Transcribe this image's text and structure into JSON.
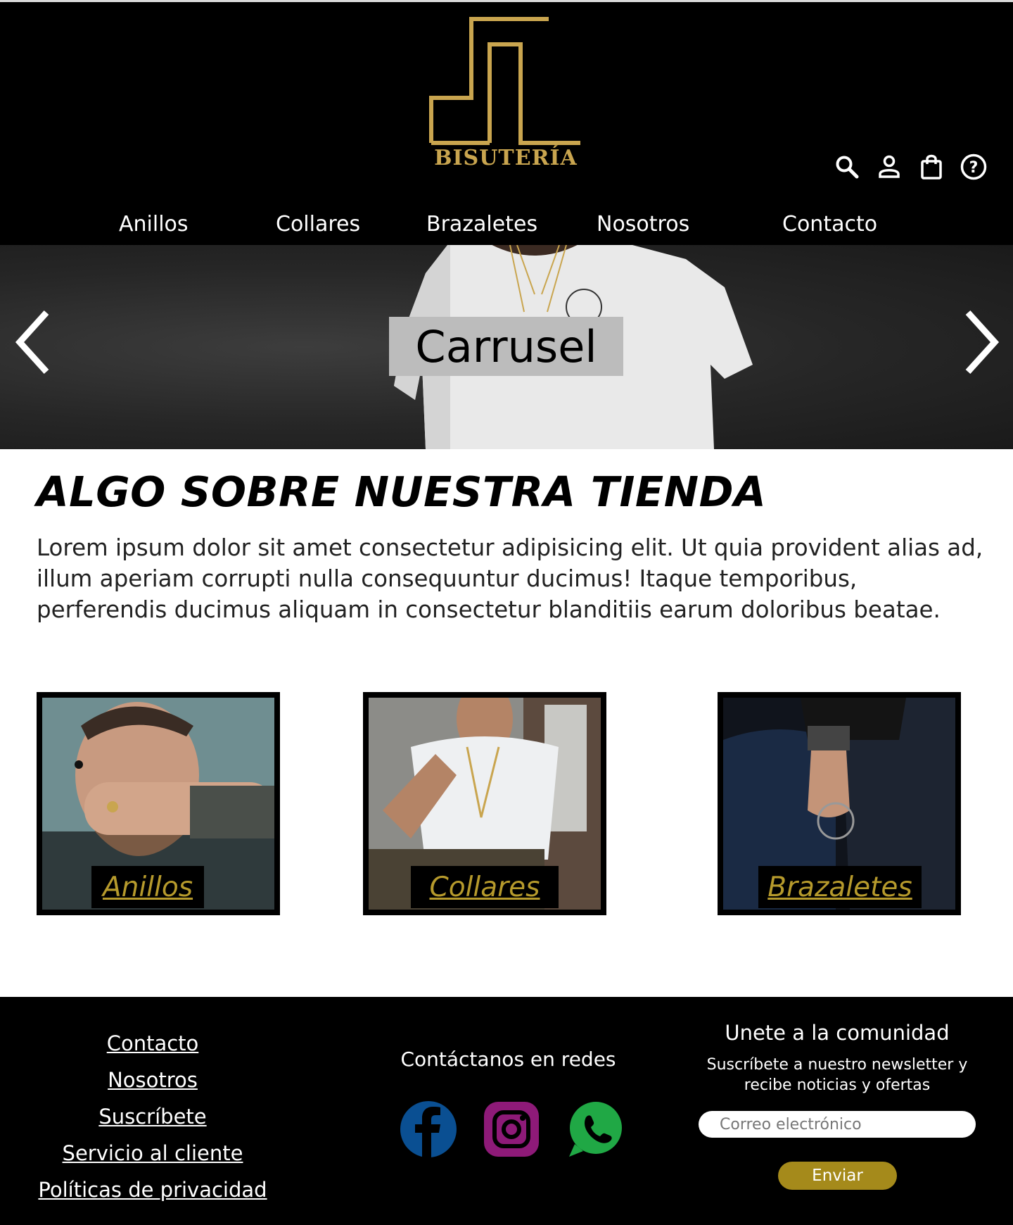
{
  "brand": {
    "logo_text": "BISUTERÍA",
    "gold": "#c9a54f"
  },
  "header_icons": [
    "search-icon",
    "user-icon",
    "shopping-bag-icon",
    "help-icon"
  ],
  "nav": {
    "items": [
      "Anillos",
      "Collares",
      "Brazaletes",
      "Nosotros",
      "Contacto"
    ]
  },
  "carousel": {
    "label": "Carrusel",
    "prev_icon": "chevron-left-icon",
    "next_icon": "chevron-right-icon"
  },
  "about": {
    "title": "ALGO SOBRE NUESTRA TIENDA",
    "text": "Lorem ipsum dolor sit amet consectetur adipisicing elit. Ut quia provident alias ad, illum aperiam corrupti nulla consequuntur ducimus! Itaque temporibus, perferendis ducimus aliquam in consectetur blanditiis earum doloribus beatae."
  },
  "categories": [
    {
      "label": "Anillos"
    },
    {
      "label": "Collares"
    },
    {
      "label": "Brazaletes"
    }
  ],
  "footer": {
    "links": [
      "Contacto",
      "Nosotros",
      "Suscríbete",
      "Servicio al cliente",
      "Políticas de privacidad"
    ],
    "social_title": "Contáctanos en redes",
    "social": [
      {
        "icon": "facebook-icon",
        "color": "#0a4f92"
      },
      {
        "icon": "instagram-icon",
        "color": "#8e1a78"
      },
      {
        "icon": "whatsapp-icon",
        "color": "#20a845"
      }
    ],
    "newsletter": {
      "title": "Unete a la comunidad",
      "subtitle": "Suscríbete a nuestro newsletter y recibe noticias y ofertas",
      "placeholder": "Correo electrónico",
      "button": "Enviar",
      "button_color": "#a58a1b"
    }
  }
}
